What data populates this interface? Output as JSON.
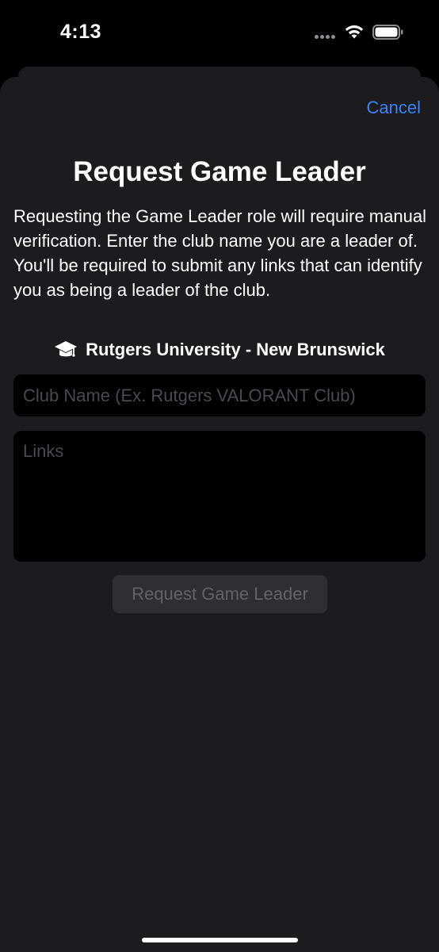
{
  "status_bar": {
    "time": "4:13"
  },
  "sheet": {
    "cancel_label": "Cancel",
    "title": "Request Game Leader",
    "description": "Requesting the Game Leader role will require manual verification. Enter the club name you are a leader of. You'll be required to submit any links that can identify you as being a leader of the club.",
    "university": {
      "icon": "graduation-cap-icon",
      "name": "Rutgers University - New Brunswick"
    },
    "club_name_field": {
      "value": "",
      "placeholder": "Club Name (Ex. Rutgers VALORANT Club)"
    },
    "links_field": {
      "value": "",
      "placeholder": "Links"
    },
    "submit_label": "Request Game Leader",
    "submit_enabled": false
  },
  "colors": {
    "accent": "#3a82f6",
    "sheet_background": "#1c1c1e",
    "field_background": "#000000",
    "placeholder": "#4a4a4e",
    "disabled_button": "#2f2f32"
  }
}
